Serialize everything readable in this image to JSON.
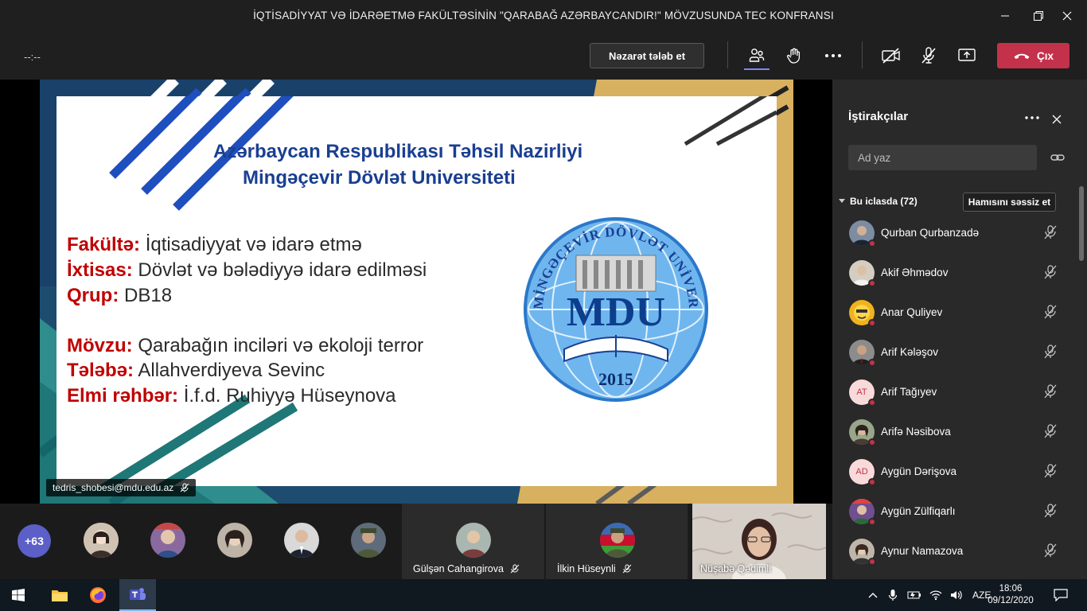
{
  "window": {
    "title": "İQTİSADİYYAT VƏ İDARƏETMƏ FAKÜLTƏSİNİN \"QARABAĞ AZƏRBAYCANDIR!\" MÖVZUSUNDA TEC KONFRANSI"
  },
  "toolbar": {
    "timer": "--:--",
    "request_control": "Nəzarət tələb et",
    "leave": "Çıx",
    "leave_color": "#c4314b",
    "icons": [
      "participants-icon",
      "raise-hand-icon",
      "more-icon",
      "camera-off-icon",
      "mic-off-icon",
      "share-icon"
    ]
  },
  "slide": {
    "heading1": "Azərbaycan Respublikası Təhsil Nazirliyi",
    "heading2": "Mingəçevir Dövlət Universiteti",
    "lines": [
      {
        "label": "Fakültə:",
        "value": "İqtisadiyyat və idarə etmə"
      },
      {
        "label": "İxtisas:",
        "value": "Dövlət və bələdiyyə idarə edilməsi"
      },
      {
        "label": "Qrup:",
        "value": "DB18"
      },
      {
        "label": "Mövzu:",
        "value": "Qarabağın inciləri və ekoloji terror"
      },
      {
        "label": "Tələbə:",
        "value": "Allahverdiyeva Sevinc"
      },
      {
        "label": "Elmi rəhbər:",
        "value": "İ.f.d. Ruhiyyə Hüseynova"
      }
    ],
    "logo": {
      "ring_text": "MİNGƏÇEVİR DÖVLƏT UNİVERSİTETİ",
      "abbr": "MDU",
      "year": "2015"
    }
  },
  "presenter": {
    "name": "tedris_shobesi@mdu.edu.az"
  },
  "strip": {
    "more_count": "+63",
    "tiles": [
      {
        "name": "Gülşən Cahangirova"
      },
      {
        "name": "İlkin Hüseynli"
      },
      {
        "name": "Nüşabə Qədimli"
      }
    ]
  },
  "panel": {
    "title": "İştirakçılar",
    "search_placeholder": "Ad yaz",
    "section": "Bu iclasda (72)",
    "mute_all": "Hamısını səssiz et",
    "participants": [
      {
        "name": "Qurban Qurbanzadə",
        "initials": ""
      },
      {
        "name": "Akif Əhmədov",
        "initials": ""
      },
      {
        "name": "Anar Quliyev",
        "initials": ""
      },
      {
        "name": "Arif Kələşov",
        "initials": ""
      },
      {
        "name": "Arif Tağıyev",
        "initials": "AT"
      },
      {
        "name": "Arifə Nəsibova",
        "initials": ""
      },
      {
        "name": "Aygün Dərişova",
        "initials": "AD"
      },
      {
        "name": "Aygün Zülfiqarlı",
        "initials": ""
      },
      {
        "name": "Aynur Namazova",
        "initials": ""
      }
    ]
  },
  "taskbar": {
    "lang": "AZE",
    "time": "18:06",
    "date": "09/12/2020",
    "apps": [
      "windows-start-icon",
      "file-explorer-icon",
      "firefox-icon",
      "teams-icon"
    ]
  }
}
